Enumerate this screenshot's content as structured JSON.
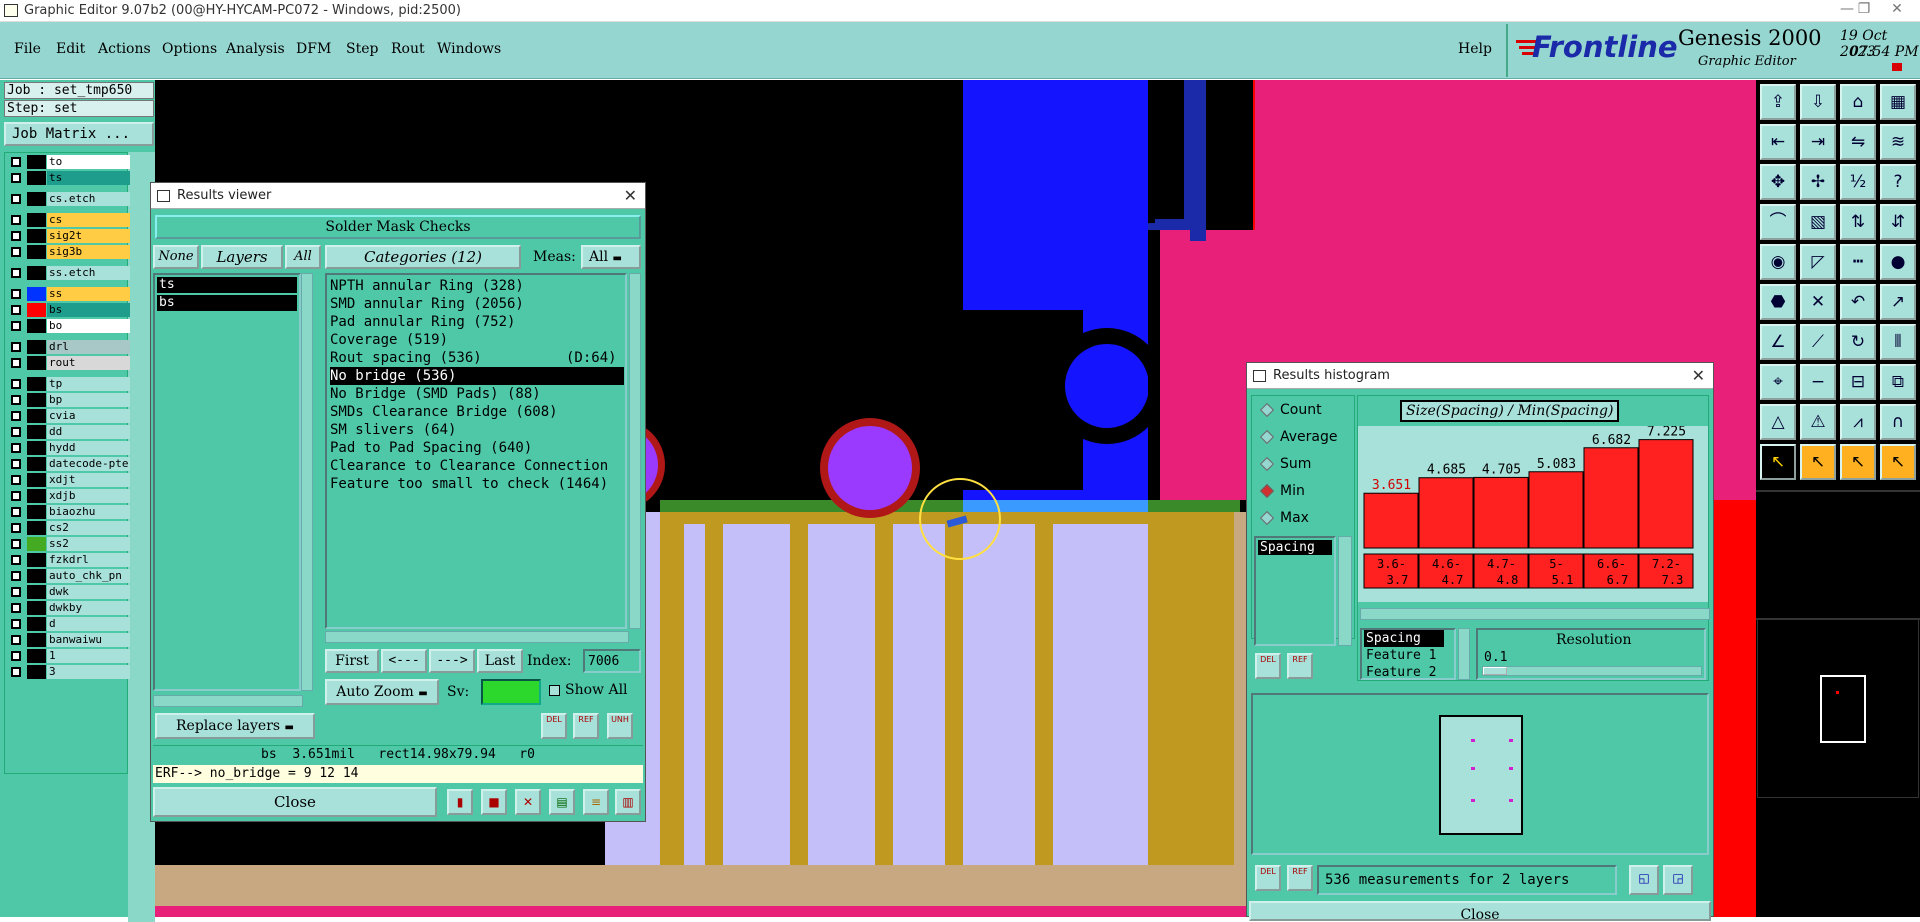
{
  "window": {
    "title": "Graphic Editor 9.07b2 (00@HY-HYCAM-PC072 - Windows, pid:2500)",
    "min_icon": "minimize-icon",
    "max_icon": "restore-icon",
    "close_icon": "close-icon"
  },
  "menu": {
    "file": "File",
    "edit": "Edit",
    "actions": "Actions",
    "options": "Options",
    "analysis": "Analysis",
    "dfm": "DFM",
    "step": "Step",
    "rout": "Rout",
    "windows": "Windows",
    "help": "Help"
  },
  "brand": {
    "logo": "Frontline",
    "product": "Genesis 2000",
    "subtitle": "Graphic Editor",
    "date": "19 Oct 2023",
    "time": "07:54 PM"
  },
  "left": {
    "job": "Job : set_tmp650",
    "step": "Step: set",
    "job_matrix": "Job Matrix ...",
    "layers": [
      {
        "name": "to",
        "color": "#ffffff",
        "swatch": "#000000"
      },
      {
        "name": "ts",
        "color": "#1e9c8c",
        "swatch": "#000000"
      },
      {
        "name": "cs.etch",
        "color": "#a8e0da",
        "swatch": "#000000"
      },
      {
        "name": "cs",
        "color": "#ffcc44",
        "swatch": "#000000"
      },
      {
        "name": "sig2t",
        "color": "#ffcc44",
        "swatch": "#000000"
      },
      {
        "name": "sig3b",
        "color": "#ffcc44",
        "swatch": "#000000"
      },
      {
        "name": "ss.etch",
        "color": "#a8e0da",
        "swatch": "#000000"
      },
      {
        "name": "ss",
        "color": "#ffcc44",
        "swatch": "#0033ff"
      },
      {
        "name": "bs",
        "color": "#1e9c8c",
        "swatch": "#ff0000"
      },
      {
        "name": "bo",
        "color": "#ffffff",
        "swatch": "#000000"
      },
      {
        "name": "drl",
        "color": "#a8c8c8",
        "swatch": "#000000"
      },
      {
        "name": "rout",
        "color": "#d8d8d8",
        "swatch": "#000000"
      },
      {
        "name": "tp",
        "color": "#a8e0da",
        "swatch": "#000000"
      },
      {
        "name": "bp",
        "color": "#a8e0da",
        "swatch": "#000000"
      },
      {
        "name": "cvia",
        "color": "#a8e0da",
        "swatch": "#000000"
      },
      {
        "name": "dd",
        "color": "#a8e0da",
        "swatch": "#000000"
      },
      {
        "name": "hydd",
        "color": "#a8e0da",
        "swatch": "#000000"
      },
      {
        "name": "datecode-pte",
        "color": "#a8e0da",
        "swatch": "#000000"
      },
      {
        "name": "xdjt",
        "color": "#a8e0da",
        "swatch": "#000000"
      },
      {
        "name": "xdjb",
        "color": "#a8e0da",
        "swatch": "#000000"
      },
      {
        "name": "biaozhu",
        "color": "#a8e0da",
        "swatch": "#000000"
      },
      {
        "name": "cs2",
        "color": "#a8e0da",
        "swatch": "#000000"
      },
      {
        "name": "ss2",
        "color": "#a8e0da",
        "swatch": "#44aa22"
      },
      {
        "name": "fzkdrl",
        "color": "#a8e0da",
        "swatch": "#000000"
      },
      {
        "name": "auto_chk_pn",
        "color": "#a8e0da",
        "swatch": "#000000"
      },
      {
        "name": "dwk",
        "color": "#a8e0da",
        "swatch": "#000000"
      },
      {
        "name": "dwkby",
        "color": "#a8e0da",
        "swatch": "#000000"
      },
      {
        "name": "d",
        "color": "#a8e0da",
        "swatch": "#000000"
      },
      {
        "name": "banwaiwu",
        "color": "#a8e0da",
        "swatch": "#000000"
      },
      {
        "name": "1",
        "color": "#a8e0da",
        "swatch": "#000000"
      },
      {
        "name": "3",
        "color": "#a8e0da",
        "swatch": "#000000"
      }
    ]
  },
  "results_viewer": {
    "title": "Results viewer",
    "header": "Solder Mask Checks",
    "none": "None",
    "layers": "Layers",
    "all": "All",
    "categories": "Categories (12)",
    "meas_label": "Meas:",
    "meas_value": "All",
    "layer_items": [
      "ts",
      "bs"
    ],
    "category_items": [
      "NPTH annular Ring (328)",
      "SMD annular Ring (2056)",
      "Pad annular Ring (752)",
      "Coverage (519)",
      "Rout spacing (536)          (D:64)",
      "No bridge (536)",
      "No Bridge (SMD Pads) (88)",
      "SMDs Clearance Bridge (608)",
      "SM slivers (64)",
      "Pad to Pad Spacing (640)",
      "Clearance to Clearance Connection",
      "Feature too small to check (1464)"
    ],
    "selected_index": 5,
    "first": "First",
    "prev": "<---",
    "next": "--->",
    "last": "Last",
    "index_label": "Index:",
    "index_value": "7006",
    "auto_zoom": "Auto Zoom",
    "sv": "Sv:",
    "show_all": "Show All",
    "replace_layers": "Replace layers",
    "del": "DEL",
    "ref": "REF",
    "unh": "UNH",
    "status": "bs  3.651mil   rect14.98x79.94   r0",
    "erf": "ERF--> no_bridge = 9 12 14",
    "close": "Close"
  },
  "histogram": {
    "title": "Results histogram",
    "modes": [
      "Count",
      "Average",
      "Sum",
      "Min",
      "Max"
    ],
    "selected_mode": "Min",
    "param_list": [
      "Spacing"
    ],
    "chart_title": "Size(Spacing) / Min(Spacing)",
    "resolution_label": "Resolution",
    "resolution_value": "0.1",
    "attrs": [
      "Spacing",
      "Feature 1",
      "Feature 2"
    ],
    "summary": "536 measurements for 2 layers",
    "close": "Close",
    "del": "DEL",
    "ref": "REF"
  },
  "chart_data": {
    "type": "bar",
    "title": "Size(Spacing) / Min(Spacing)",
    "categories": [
      "3.6-3.7",
      "4.6-4.7",
      "4.7-4.8",
      "5-5.1",
      "6.6-6.7",
      "7.2-7.3"
    ],
    "values": [
      3.651,
      4.685,
      4.705,
      5.083,
      6.682,
      7.225
    ],
    "value_labels": [
      "3.651",
      "4.685",
      "4.705",
      "5.083",
      "6.682",
      "7.225"
    ],
    "highlight_index": 0,
    "ylim": [
      0,
      7.6
    ],
    "bar_color": "#ff2020"
  },
  "colors": {
    "panel": "#4fc8a8",
    "menubar": "#96d6d0",
    "button": "#a8e0da",
    "logo_red": "#d80000",
    "logo_blue": "#1a2aa8"
  }
}
